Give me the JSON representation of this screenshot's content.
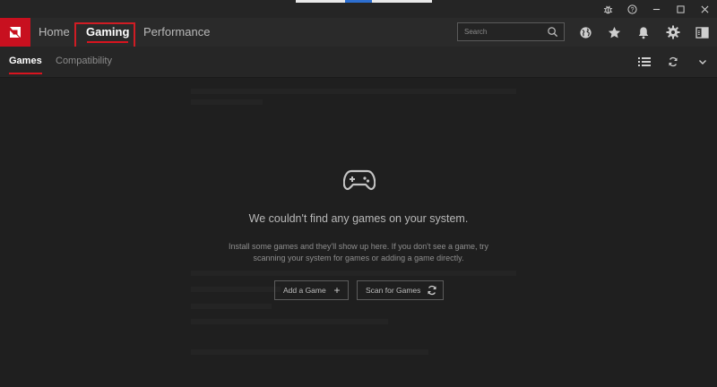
{
  "nav": {
    "home": "Home",
    "gaming": "Gaming",
    "performance": "Performance"
  },
  "search": {
    "placeholder": "Search"
  },
  "subnav": {
    "games": "Games",
    "compatibility": "Compatibility"
  },
  "empty_state": {
    "title": "We couldn't find any games on your system.",
    "description": "Install some games and they'll show up here. If you don't see a game, try scanning your system for games or adding a game directly.",
    "add_button": "Add a Game",
    "scan_button": "Scan for Games"
  },
  "colors": {
    "accent": "#d8141f",
    "logo_bg": "#c8101f",
    "background": "#1f1f1f",
    "highlight_box": "#d01c24"
  },
  "icons": [
    "amd-logo-icon",
    "bug-icon",
    "help-icon",
    "minimize-icon",
    "maximize-icon",
    "close-icon",
    "search-icon",
    "globe-icon",
    "star-icon",
    "bell-icon",
    "gear-icon",
    "sidebar-toggle-icon",
    "list-view-icon",
    "refresh-icon",
    "gamepad-icon",
    "plus-icon"
  ]
}
